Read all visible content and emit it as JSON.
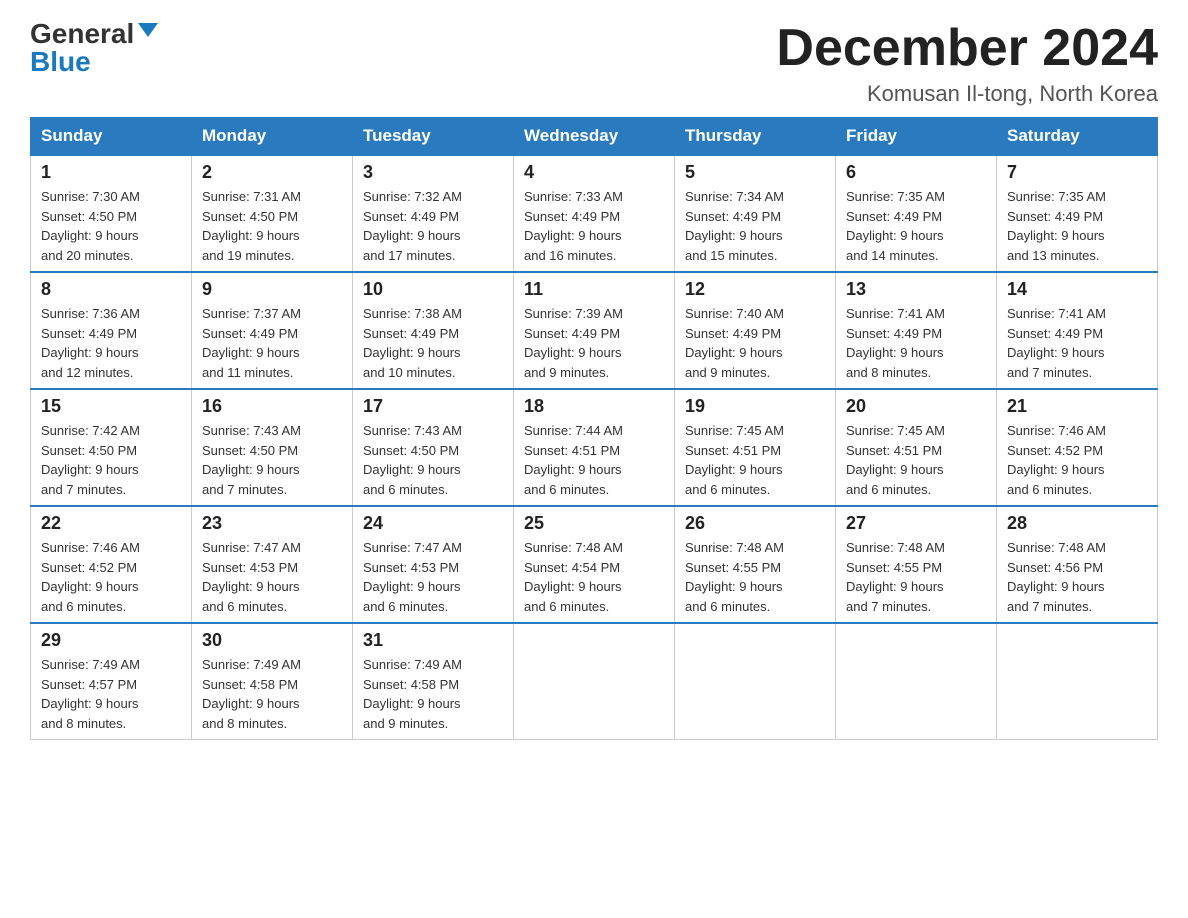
{
  "logo": {
    "general": "General",
    "blue": "Blue"
  },
  "title": "December 2024",
  "subtitle": "Komusan Il-tong, North Korea",
  "days_of_week": [
    "Sunday",
    "Monday",
    "Tuesday",
    "Wednesday",
    "Thursday",
    "Friday",
    "Saturday"
  ],
  "weeks": [
    [
      {
        "day": "1",
        "sunrise": "7:30 AM",
        "sunset": "4:50 PM",
        "daylight": "9 hours and 20 minutes."
      },
      {
        "day": "2",
        "sunrise": "7:31 AM",
        "sunset": "4:50 PM",
        "daylight": "9 hours and 19 minutes."
      },
      {
        "day": "3",
        "sunrise": "7:32 AM",
        "sunset": "4:49 PM",
        "daylight": "9 hours and 17 minutes."
      },
      {
        "day": "4",
        "sunrise": "7:33 AM",
        "sunset": "4:49 PM",
        "daylight": "9 hours and 16 minutes."
      },
      {
        "day": "5",
        "sunrise": "7:34 AM",
        "sunset": "4:49 PM",
        "daylight": "9 hours and 15 minutes."
      },
      {
        "day": "6",
        "sunrise": "7:35 AM",
        "sunset": "4:49 PM",
        "daylight": "9 hours and 14 minutes."
      },
      {
        "day": "7",
        "sunrise": "7:35 AM",
        "sunset": "4:49 PM",
        "daylight": "9 hours and 13 minutes."
      }
    ],
    [
      {
        "day": "8",
        "sunrise": "7:36 AM",
        "sunset": "4:49 PM",
        "daylight": "9 hours and 12 minutes."
      },
      {
        "day": "9",
        "sunrise": "7:37 AM",
        "sunset": "4:49 PM",
        "daylight": "9 hours and 11 minutes."
      },
      {
        "day": "10",
        "sunrise": "7:38 AM",
        "sunset": "4:49 PM",
        "daylight": "9 hours and 10 minutes."
      },
      {
        "day": "11",
        "sunrise": "7:39 AM",
        "sunset": "4:49 PM",
        "daylight": "9 hours and 9 minutes."
      },
      {
        "day": "12",
        "sunrise": "7:40 AM",
        "sunset": "4:49 PM",
        "daylight": "9 hours and 9 minutes."
      },
      {
        "day": "13",
        "sunrise": "7:41 AM",
        "sunset": "4:49 PM",
        "daylight": "9 hours and 8 minutes."
      },
      {
        "day": "14",
        "sunrise": "7:41 AM",
        "sunset": "4:49 PM",
        "daylight": "9 hours and 7 minutes."
      }
    ],
    [
      {
        "day": "15",
        "sunrise": "7:42 AM",
        "sunset": "4:50 PM",
        "daylight": "9 hours and 7 minutes."
      },
      {
        "day": "16",
        "sunrise": "7:43 AM",
        "sunset": "4:50 PM",
        "daylight": "9 hours and 7 minutes."
      },
      {
        "day": "17",
        "sunrise": "7:43 AM",
        "sunset": "4:50 PM",
        "daylight": "9 hours and 6 minutes."
      },
      {
        "day": "18",
        "sunrise": "7:44 AM",
        "sunset": "4:51 PM",
        "daylight": "9 hours and 6 minutes."
      },
      {
        "day": "19",
        "sunrise": "7:45 AM",
        "sunset": "4:51 PM",
        "daylight": "9 hours and 6 minutes."
      },
      {
        "day": "20",
        "sunrise": "7:45 AM",
        "sunset": "4:51 PM",
        "daylight": "9 hours and 6 minutes."
      },
      {
        "day": "21",
        "sunrise": "7:46 AM",
        "sunset": "4:52 PM",
        "daylight": "9 hours and 6 minutes."
      }
    ],
    [
      {
        "day": "22",
        "sunrise": "7:46 AM",
        "sunset": "4:52 PM",
        "daylight": "9 hours and 6 minutes."
      },
      {
        "day": "23",
        "sunrise": "7:47 AM",
        "sunset": "4:53 PM",
        "daylight": "9 hours and 6 minutes."
      },
      {
        "day": "24",
        "sunrise": "7:47 AM",
        "sunset": "4:53 PM",
        "daylight": "9 hours and 6 minutes."
      },
      {
        "day": "25",
        "sunrise": "7:48 AM",
        "sunset": "4:54 PM",
        "daylight": "9 hours and 6 minutes."
      },
      {
        "day": "26",
        "sunrise": "7:48 AM",
        "sunset": "4:55 PM",
        "daylight": "9 hours and 6 minutes."
      },
      {
        "day": "27",
        "sunrise": "7:48 AM",
        "sunset": "4:55 PM",
        "daylight": "9 hours and 7 minutes."
      },
      {
        "day": "28",
        "sunrise": "7:48 AM",
        "sunset": "4:56 PM",
        "daylight": "9 hours and 7 minutes."
      }
    ],
    [
      {
        "day": "29",
        "sunrise": "7:49 AM",
        "sunset": "4:57 PM",
        "daylight": "9 hours and 8 minutes."
      },
      {
        "day": "30",
        "sunrise": "7:49 AM",
        "sunset": "4:58 PM",
        "daylight": "9 hours and 8 minutes."
      },
      {
        "day": "31",
        "sunrise": "7:49 AM",
        "sunset": "4:58 PM",
        "daylight": "9 hours and 9 minutes."
      },
      null,
      null,
      null,
      null
    ]
  ],
  "labels": {
    "sunrise": "Sunrise:",
    "sunset": "Sunset:",
    "daylight": "Daylight:"
  }
}
